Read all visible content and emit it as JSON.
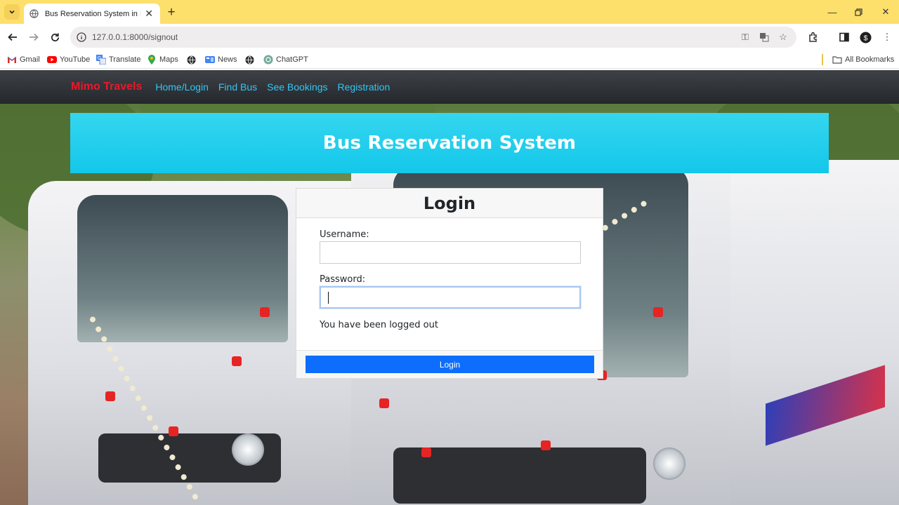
{
  "browser": {
    "tab": {
      "title": "Bus Reservation System in Djan"
    },
    "address_bar": {
      "url": "127.0.0.1:8000/signout"
    },
    "bookmarks": [
      {
        "label": "Gmail",
        "icon": "gmail-icon"
      },
      {
        "label": "YouTube",
        "icon": "youtube-icon"
      },
      {
        "label": "Translate",
        "icon": "translate-icon"
      },
      {
        "label": "Maps",
        "icon": "maps-icon"
      },
      {
        "label": "",
        "icon": "globe-icon"
      },
      {
        "label": "News",
        "icon": "news-icon"
      },
      {
        "label": "",
        "icon": "globe-icon"
      },
      {
        "label": "ChatGPT",
        "icon": "chatgpt-icon"
      }
    ],
    "all_bookmarks": "All Bookmarks"
  },
  "navbar": {
    "brand": "Mimo Travels",
    "links": [
      "Home/Login",
      "Find Bus",
      "See Bookings",
      "Registration"
    ]
  },
  "banner": {
    "title": "Bus Reservation System"
  },
  "login_card": {
    "title": "Login",
    "username_label": "Username:",
    "username_value": "",
    "password_label": "Password:",
    "password_value": "",
    "message": "You have been logged out",
    "submit_label": "Login"
  },
  "colors": {
    "brand": "#e8192c",
    "nav_link": "#34c6f4",
    "banner": "#1fcbec",
    "primary_button": "#0d6efd",
    "tabstrip": "#fddf6b"
  }
}
